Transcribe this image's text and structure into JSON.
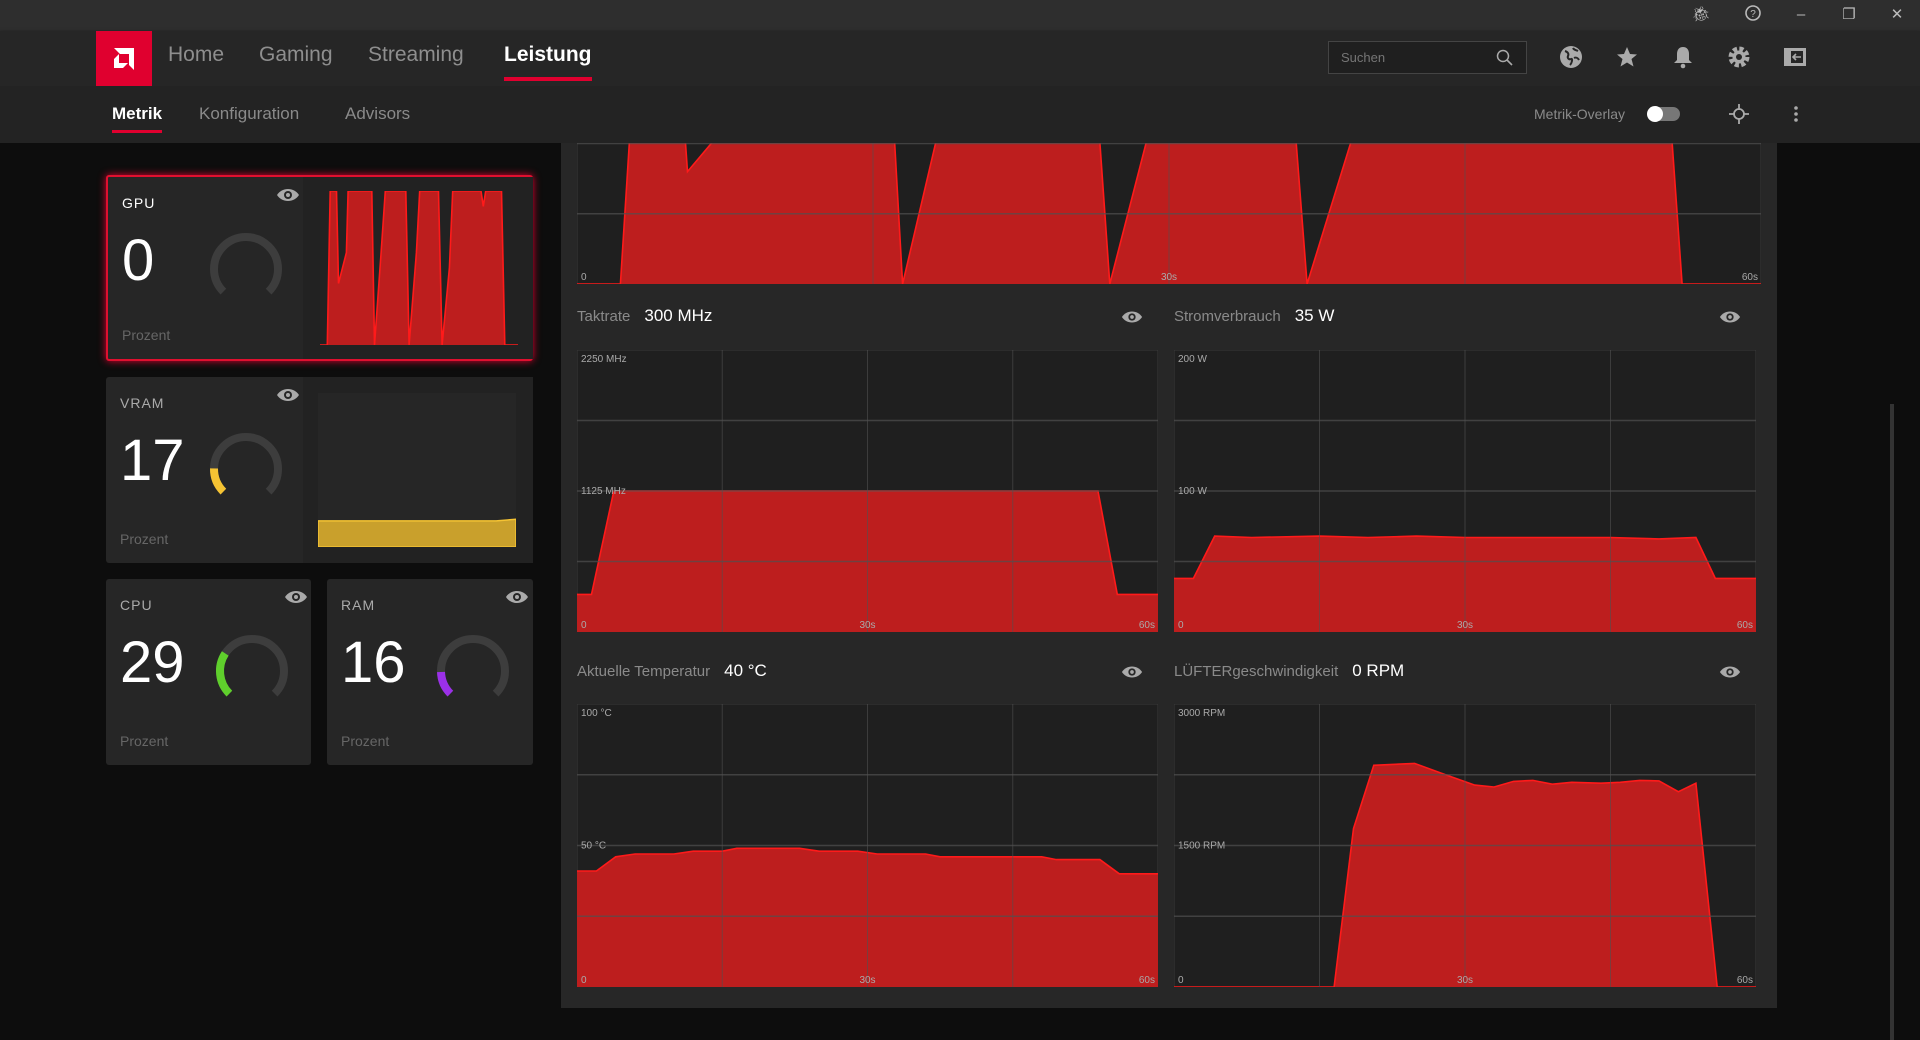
{
  "window": {
    "controls": [
      "bug-report-icon",
      "help-icon",
      "minimize-icon",
      "restore-icon",
      "close-icon"
    ]
  },
  "nav": {
    "tabs": [
      {
        "label": "Home"
      },
      {
        "label": "Gaming"
      },
      {
        "label": "Streaming"
      },
      {
        "label": "Leistung",
        "active": true
      }
    ],
    "search_placeholder": "Suchen",
    "icons": [
      "globe-icon",
      "star-icon",
      "bell-icon",
      "gear-icon",
      "sidebar-toggle-icon"
    ]
  },
  "subnav": {
    "tabs": [
      {
        "label": "Metrik",
        "active": true
      },
      {
        "label": "Konfiguration"
      },
      {
        "label": "Advisors"
      }
    ],
    "overlay_label": "Metrik-Overlay",
    "overlay_on": false
  },
  "colors": {
    "accent": "#e0002f",
    "chart_fill": "#bd1e1e",
    "chart_line": "#ff1a1a",
    "vram": "#f5c333",
    "cpu": "#5fcf2c",
    "ram": "#9b30e8"
  },
  "cards": [
    {
      "label": "GPU",
      "value": "0",
      "unit": "Prozent",
      "percent": 0,
      "color": "#e0002f",
      "selected": true
    },
    {
      "label": "VRAM",
      "value": "17",
      "unit": "Prozent",
      "percent": 17,
      "color": "#f5c333"
    },
    {
      "label": "CPU",
      "value": "29",
      "unit": "Prozent",
      "percent": 29,
      "color": "#5fcf2c"
    },
    {
      "label": "RAM",
      "value": "16",
      "unit": "Prozent",
      "percent": 16,
      "color": "#9b30e8"
    }
  ],
  "chart_data": [
    {
      "type": "area",
      "ylim": [
        0,
        100
      ],
      "xlim": [
        0,
        60
      ],
      "grid": true,
      "x_ticks": [
        "0",
        "30s",
        "60s"
      ],
      "points": [
        [
          0,
          0
        ],
        [
          2.2,
          0
        ],
        [
          3.1,
          100
        ],
        [
          5,
          100
        ],
        [
          5.6,
          40
        ],
        [
          8,
          60
        ],
        [
          8.5,
          100
        ],
        [
          15.7,
          100
        ],
        [
          16.5,
          0
        ],
        [
          18.5,
          60
        ],
        [
          19.8,
          100
        ],
        [
          26,
          100
        ],
        [
          27,
          0
        ],
        [
          29.2,
          60
        ],
        [
          30.2,
          100
        ],
        [
          35.9,
          100
        ],
        [
          37,
          0
        ],
        [
          39.2,
          50
        ],
        [
          40.2,
          100
        ],
        [
          48.8,
          100
        ],
        [
          49.5,
          90
        ],
        [
          50.2,
          100
        ],
        [
          55,
          100
        ],
        [
          56,
          0
        ],
        [
          60,
          0
        ]
      ]
    },
    {
      "type": "area",
      "title": "Taktrate",
      "current": "300 MHz",
      "ylim": [
        0,
        2250
      ],
      "xlim": [
        0,
        60
      ],
      "grid": true,
      "y_ticks": [
        "2250 MHz",
        "1125 MHz"
      ],
      "x_ticks": [
        "0",
        "30s",
        "60s"
      ],
      "points": [
        [
          0,
          300
        ],
        [
          1.5,
          300
        ],
        [
          3.8,
          1125
        ],
        [
          53.8,
          1125
        ],
        [
          55.8,
          300
        ],
        [
          60,
          300
        ]
      ]
    },
    {
      "type": "area",
      "title": "Stromverbrauch",
      "current": "35 W",
      "ylim": [
        0,
        200
      ],
      "xlim": [
        0,
        60
      ],
      "grid": true,
      "y_ticks": [
        "200 W",
        "100 W"
      ],
      "x_ticks": [
        "0",
        "30s",
        "60s"
      ],
      "points": [
        [
          0,
          38
        ],
        [
          2,
          38
        ],
        [
          4.2,
          68
        ],
        [
          8,
          67
        ],
        [
          15,
          68
        ],
        [
          20,
          67
        ],
        [
          25,
          68
        ],
        [
          30,
          67
        ],
        [
          35,
          67
        ],
        [
          40,
          67
        ],
        [
          45,
          67
        ],
        [
          50,
          66
        ],
        [
          53.8,
          67
        ],
        [
          55.8,
          38
        ],
        [
          60,
          38
        ]
      ]
    },
    {
      "type": "area",
      "title": "Aktuelle Temperatur",
      "current": "40 °C",
      "ylim": [
        0,
        100
      ],
      "xlim": [
        0,
        60
      ],
      "grid": true,
      "y_ticks": [
        "100 °C",
        "50 °C"
      ],
      "x_ticks": [
        "0",
        "30s",
        "60s"
      ],
      "points": [
        [
          0,
          41
        ],
        [
          2,
          41
        ],
        [
          4,
          46
        ],
        [
          6,
          47
        ],
        [
          10,
          47
        ],
        [
          12,
          48
        ],
        [
          15,
          48
        ],
        [
          16.5,
          49
        ],
        [
          23,
          49
        ],
        [
          25,
          48
        ],
        [
          29,
          48
        ],
        [
          31,
          47
        ],
        [
          36,
          47
        ],
        [
          37.5,
          46
        ],
        [
          48,
          46
        ],
        [
          49.5,
          45
        ],
        [
          54,
          45
        ],
        [
          56,
          40
        ],
        [
          60,
          40
        ]
      ]
    },
    {
      "type": "area",
      "title": "LÜFTERgeschwindigkeit",
      "current": "0 RPM",
      "ylim": [
        0,
        3000
      ],
      "xlim": [
        0,
        60
      ],
      "grid": true,
      "y_ticks": [
        "3000 RPM",
        "1500 RPM"
      ],
      "x_ticks": [
        "0",
        "30s",
        "60s"
      ],
      "points": [
        [
          0,
          0
        ],
        [
          16.5,
          0
        ],
        [
          18.5,
          1680
        ],
        [
          20.6,
          2350
        ],
        [
          24.8,
          2370
        ],
        [
          28,
          2250
        ],
        [
          31,
          2140
        ],
        [
          33,
          2120
        ],
        [
          35,
          2180
        ],
        [
          37,
          2190
        ],
        [
          39,
          2150
        ],
        [
          41,
          2170
        ],
        [
          44,
          2160
        ],
        [
          46,
          2170
        ],
        [
          48,
          2190
        ],
        [
          50,
          2185
        ],
        [
          52,
          2070
        ],
        [
          53.8,
          2160
        ],
        [
          56,
          0
        ],
        [
          60,
          0
        ]
      ]
    }
  ],
  "vram_series": [
    17,
    17,
    17,
    17,
    17,
    17,
    17,
    17,
    17,
    17,
    18
  ]
}
